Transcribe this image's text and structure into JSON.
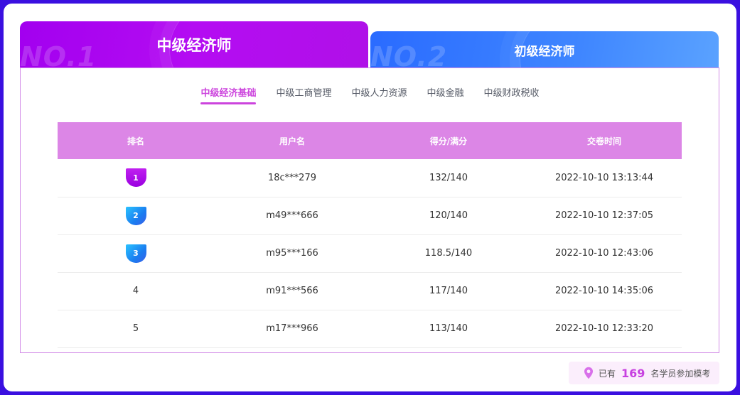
{
  "tabs": [
    {
      "label": "中级经济师",
      "watermark": "NO.1",
      "active": true
    },
    {
      "label": "初级经济师",
      "watermark": "NO.2",
      "active": false
    }
  ],
  "subtabs": [
    {
      "label": "中级经济基础",
      "active": true
    },
    {
      "label": "中级工商管理",
      "active": false
    },
    {
      "label": "中级人力资源",
      "active": false
    },
    {
      "label": "中级金融",
      "active": false
    },
    {
      "label": "中级财政税收",
      "active": false
    }
  ],
  "table": {
    "headers": [
      "排名",
      "用户名",
      "得分/满分",
      "交卷时间"
    ],
    "rows": [
      {
        "rank": "1",
        "user": "18c***279",
        "score": "132/140",
        "time": "2022-10-10 13:13:44"
      },
      {
        "rank": "2",
        "user": "m49***666",
        "score": "120/140",
        "time": "2022-10-10 12:37:05"
      },
      {
        "rank": "3",
        "user": "m95***166",
        "score": "118.5/140",
        "time": "2022-10-10 12:43:06"
      },
      {
        "rank": "4",
        "user": "m91***566",
        "score": "117/140",
        "time": "2022-10-10 14:35:06"
      },
      {
        "rank": "5",
        "user": "m17***966",
        "score": "113/140",
        "time": "2022-10-10 12:33:20"
      }
    ]
  },
  "footer": {
    "prefix": "已有",
    "count": "169",
    "suffix": "名学员参加模考",
    "icon": "location-pin-icon"
  },
  "colors": {
    "accent": "#cc44dd",
    "header": "#dc86e6",
    "tab1": "#a200ef",
    "tab2": "#2a6bff",
    "background": "#3a0fe0"
  }
}
